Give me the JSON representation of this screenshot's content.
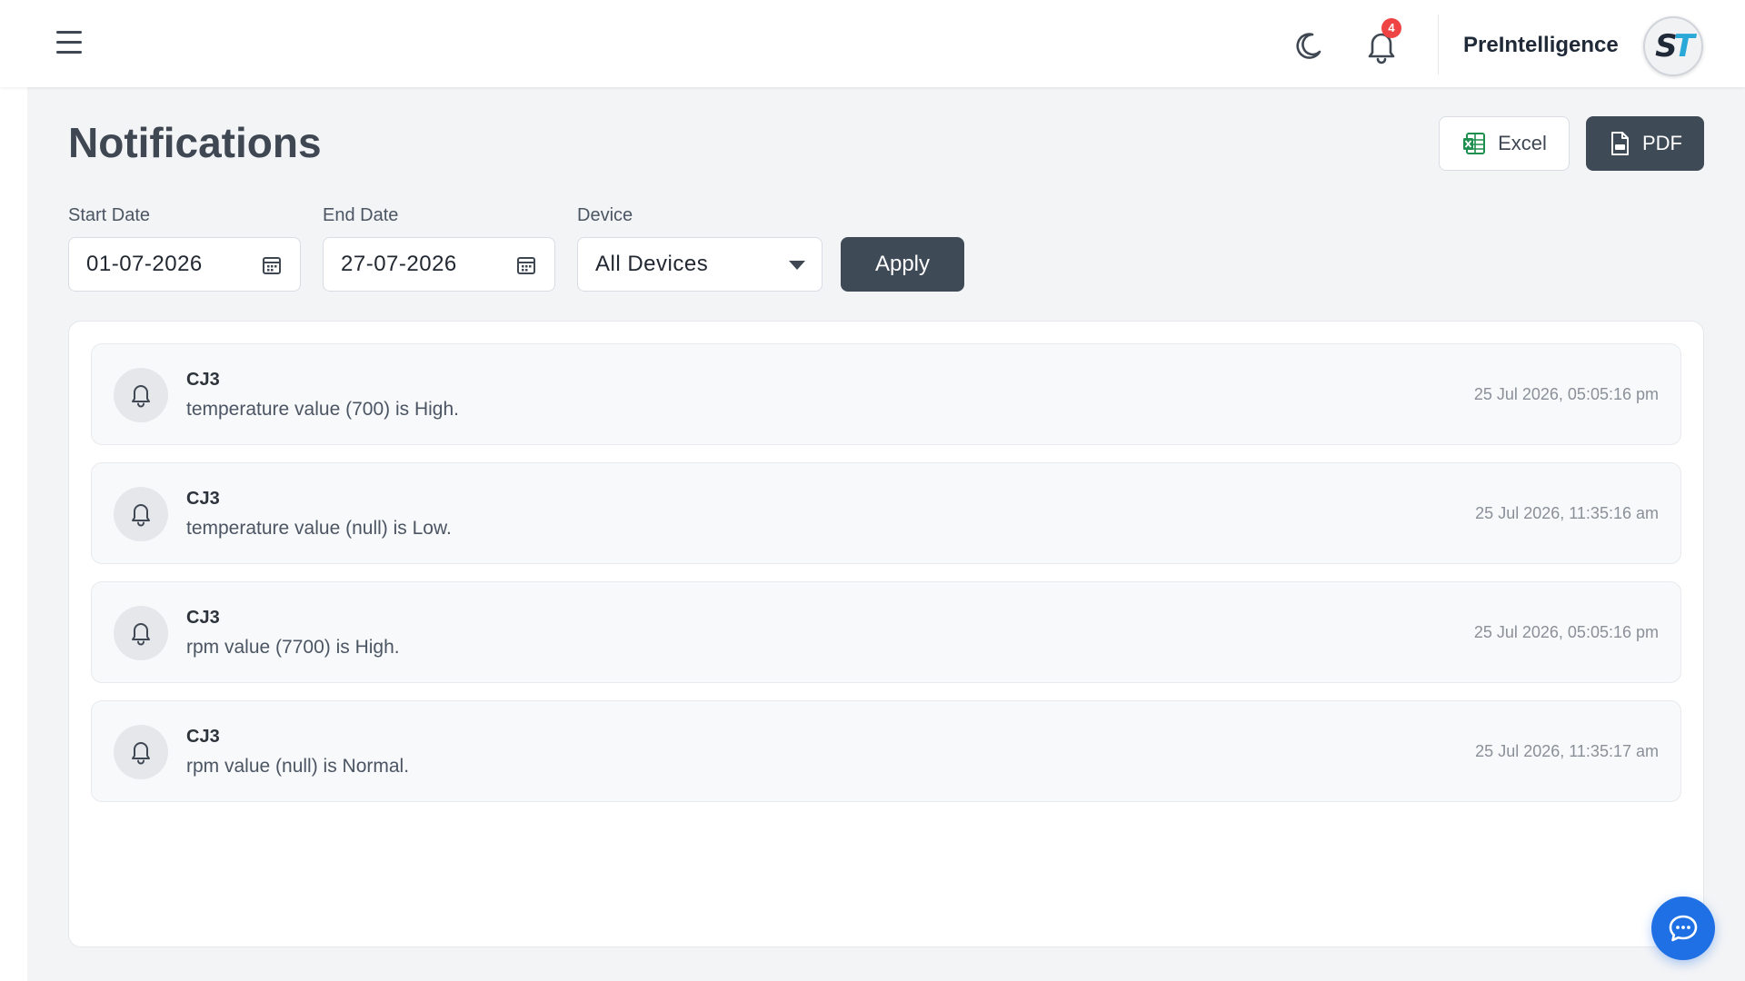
{
  "header": {
    "brand": "PreIntelligence",
    "notification_count": "4",
    "avatar": {
      "first": "S",
      "second": "T"
    },
    "icons": {
      "menu": "hamburger-menu-icon",
      "theme": "moon-icon",
      "notifications": "bell-icon"
    }
  },
  "page": {
    "title": "Notifications",
    "export": {
      "excel_label": "Excel",
      "pdf_label": "PDF"
    }
  },
  "filters": {
    "start_date_label": "Start Date",
    "start_date_value": "01-07-2026",
    "end_date_label": "End Date",
    "end_date_value": "27-07-2026",
    "device_label": "Device",
    "device_value": "All Devices",
    "apply_label": "Apply"
  },
  "notifications": [
    {
      "device": "CJ3",
      "message": "temperature value (700) is High.",
      "time": "25 Jul 2026, 05:05:16 pm"
    },
    {
      "device": "CJ3",
      "message": "temperature value (null) is Low.",
      "time": "25 Jul 2026, 11:35:16 am"
    },
    {
      "device": "CJ3",
      "message": "rpm value (7700) is High.",
      "time": "25 Jul 2026, 05:05:16 pm"
    },
    {
      "device": "CJ3",
      "message": "rpm value (null) is Normal.",
      "time": "25 Jul 2026, 11:35:17 am"
    }
  ],
  "colors": {
    "primary_dark": "#3f4a57",
    "background": "#f3f4f6",
    "badge": "#ef4444",
    "chat_fab": "#1f6fe5",
    "excel_green": "#1e8f4e"
  }
}
